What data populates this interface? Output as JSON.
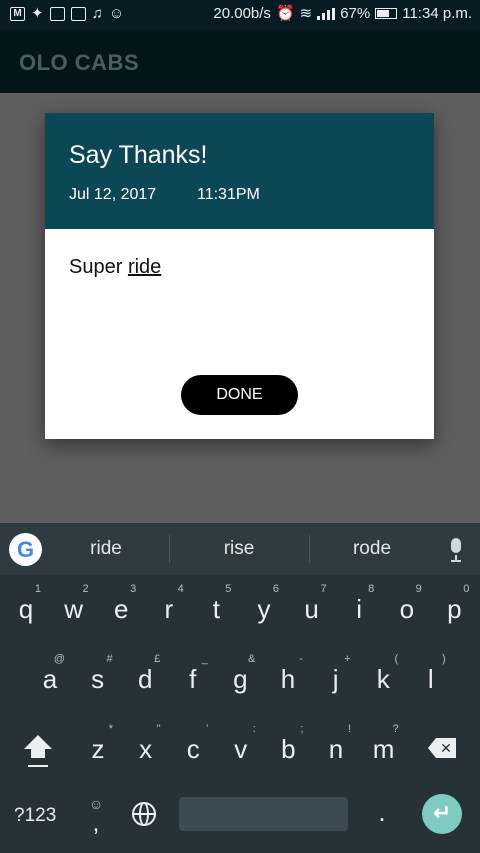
{
  "status_bar": {
    "notif_icons": [
      "M",
      "twitter-icon",
      "message-icon",
      "image-icon",
      "music-icon",
      "emoji-icon"
    ],
    "speed": "20.00b/s",
    "battery_pct": "67%",
    "battery_level": 0.67,
    "time": "11:34 p.m."
  },
  "app_bar": {
    "title": "OLO CABS"
  },
  "dialog": {
    "title": "Say Thanks!",
    "date": "Jul 12, 2017",
    "time": "11:31PM",
    "message_plain": "Super ",
    "message_underlined": "ride",
    "done_label": "DONE",
    "header_color": "#0c4756"
  },
  "keyboard": {
    "suggestions": [
      "ride",
      "rise",
      "rode"
    ],
    "rows": [
      [
        {
          "k": "q",
          "h": "1"
        },
        {
          "k": "w",
          "h": "2"
        },
        {
          "k": "e",
          "h": "3"
        },
        {
          "k": "r",
          "h": "4"
        },
        {
          "k": "t",
          "h": "5"
        },
        {
          "k": "y",
          "h": "6"
        },
        {
          "k": "u",
          "h": "7"
        },
        {
          "k": "i",
          "h": "8"
        },
        {
          "k": "o",
          "h": "9"
        },
        {
          "k": "p",
          "h": "0"
        }
      ],
      [
        {
          "k": "a",
          "h": "@"
        },
        {
          "k": "s",
          "h": "#"
        },
        {
          "k": "d",
          "h": "£"
        },
        {
          "k": "f",
          "h": "_"
        },
        {
          "k": "g",
          "h": "&"
        },
        {
          "k": "h",
          "h": "-"
        },
        {
          "k": "j",
          "h": "+"
        },
        {
          "k": "k",
          "h": "("
        },
        {
          "k": "l",
          "h": ")"
        }
      ],
      [
        {
          "k": "z",
          "h": "*"
        },
        {
          "k": "x",
          "h": "\""
        },
        {
          "k": "c",
          "h": "'"
        },
        {
          "k": "v",
          "h": ":"
        },
        {
          "k": "b",
          "h": ";"
        },
        {
          "k": "n",
          "h": "!"
        },
        {
          "k": "m",
          "h": "?"
        }
      ]
    ],
    "sym_label": "?123",
    "emoji_hint": "☺",
    "comma": ",",
    "period": ".",
    "enter_color": "#7ecbc2"
  }
}
